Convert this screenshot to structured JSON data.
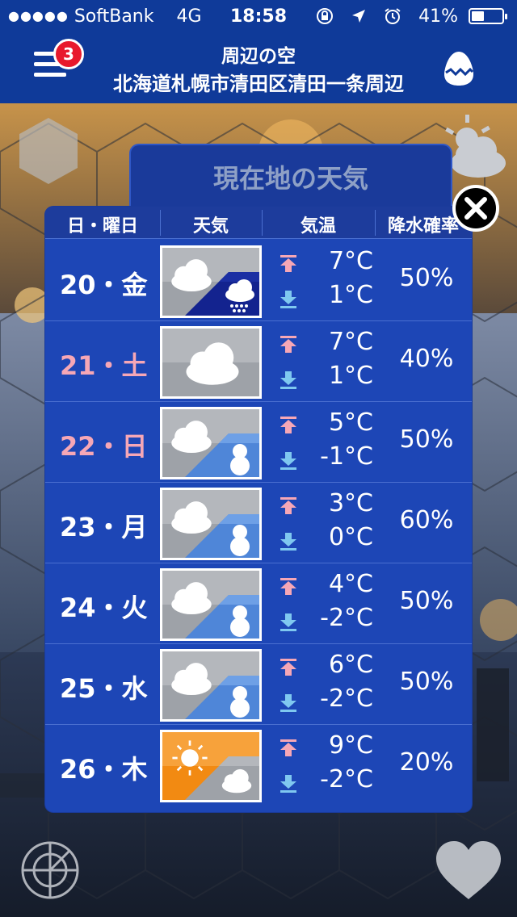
{
  "status_bar": {
    "signal": "●●●●●",
    "carrier": "SoftBank",
    "network": "4G",
    "time": "18:58",
    "battery": "41%",
    "battery_level": 0.41,
    "icons": [
      "orientation-lock-icon",
      "location-arrow-icon",
      "alarm-icon"
    ]
  },
  "header": {
    "subtitle": "周辺の空",
    "location": "北海道札幌市清田区清田一条周辺",
    "notification_count": "3",
    "menu_icon": "hamburger-menu-icon",
    "right_icon": "egg-icon"
  },
  "panel": {
    "title": "現在地の天気",
    "columns": [
      "日・曜日",
      "天気",
      "気温",
      "降水確率"
    ],
    "close_icon": "close-icon"
  },
  "forecast": [
    {
      "day": "20・金",
      "weekend": false,
      "weather": "cloudy-then-rain-snow",
      "high": "7°C",
      "low": "1°C",
      "pop": "50%"
    },
    {
      "day": "21・土",
      "weekend": true,
      "weather": "cloudy",
      "high": "7°C",
      "low": "1°C",
      "pop": "40%"
    },
    {
      "day": "22・日",
      "weekend": true,
      "weather": "cloudy-then-snow",
      "high": "5°C",
      "low": "-1°C",
      "pop": "50%"
    },
    {
      "day": "23・月",
      "weekend": false,
      "weather": "cloudy-then-snow",
      "high": "3°C",
      "low": "0°C",
      "pop": "60%"
    },
    {
      "day": "24・火",
      "weekend": false,
      "weather": "cloudy-then-snow",
      "high": "4°C",
      "low": "-2°C",
      "pop": "50%"
    },
    {
      "day": "25・水",
      "weekend": false,
      "weather": "cloudy-then-snow",
      "high": "6°C",
      "low": "-2°C",
      "pop": "50%"
    },
    {
      "day": "26・木",
      "weekend": false,
      "weather": "sunny-then-cloudy",
      "high": "9°C",
      "low": "-2°C",
      "pop": "20%"
    }
  ],
  "bottom": {
    "left_icon": "radar-icon",
    "right_icon": "heart-icon"
  },
  "colors": {
    "header_blue": "#0f3a99",
    "panel_blue": "#1d46b6",
    "weekend_pink": "#f6a7b6",
    "badge_red": "#e8192c",
    "arrow_up": "#f6a7b6",
    "arrow_down": "#7fc8f0"
  }
}
